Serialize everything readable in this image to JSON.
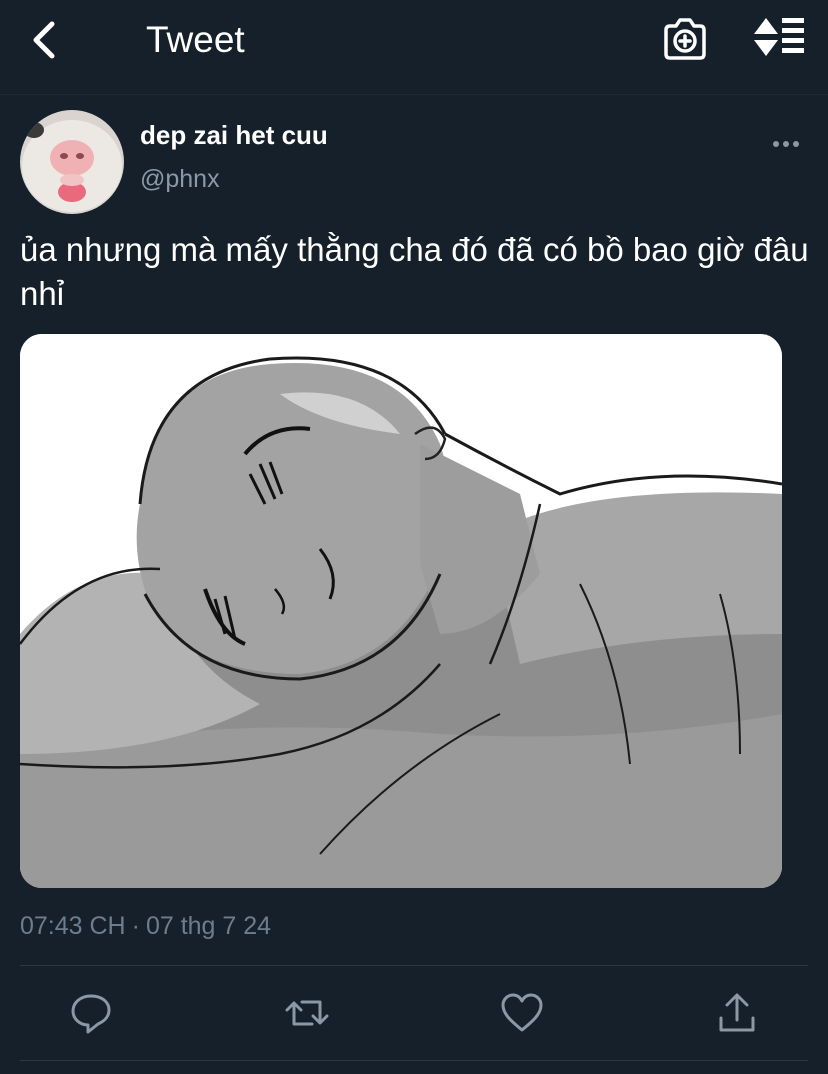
{
  "header": {
    "title": "Tweet",
    "back_icon": "chevron-left-icon",
    "camera_icon": "camera-plus-icon",
    "sort_icon": "sort-list-icon"
  },
  "tweet": {
    "display_name": "dep zai het cuu",
    "handle": "@phnx",
    "text": "ủa nhưng mà mấy thằng cha đó đã có bồ bao giờ đâu nhỉ",
    "time": "07:43 CH",
    "separator": "·",
    "date": "07 thg 7 24"
  },
  "actions": [
    "reply-icon",
    "retweet-icon",
    "like-icon",
    "share-icon"
  ],
  "colors": {
    "background": "#15202b",
    "secondary_text": "#8b98a5",
    "divider": "#2b3844"
  }
}
